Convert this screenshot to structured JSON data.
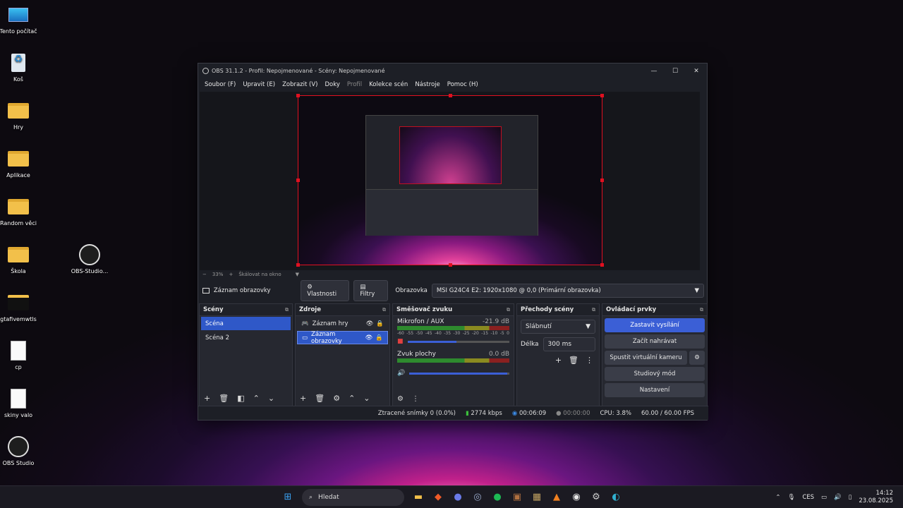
{
  "desktop": {
    "icons": [
      {
        "label": "Tento počítač"
      },
      {
        "label": "Koš"
      },
      {
        "label": "Hry"
      },
      {
        "label": "Aplikace"
      },
      {
        "label": "Random věci"
      },
      {
        "label": "Škola"
      },
      {
        "label": "OBS-Studio..."
      },
      {
        "label": "gtafivemwtls"
      },
      {
        "label": "cp"
      },
      {
        "label": "skiny valo"
      },
      {
        "label": "OBS Studio"
      }
    ]
  },
  "window": {
    "title": "OBS 31.1.2 - Profil: Nepojmenované - Scény: Nepojmenované",
    "controls": [
      "—",
      "☐",
      "✕"
    ]
  },
  "menu": [
    "Soubor (F)",
    "Upravit (E)",
    "Zobrazit (V)",
    "Doky",
    "Profil",
    "Kolekce scén",
    "Nástroje",
    "Pomoc (H)"
  ],
  "zoom": {
    "minus": "−",
    "value": "33%",
    "plus": "+",
    "mode": "Škálovat na okno"
  },
  "source_bar": {
    "name": "Záznam obrazovky",
    "properties": "Vlastnosti",
    "filters": "Filtry",
    "display_label": "Obrazovka",
    "display_value": "MSI G24C4 E2: 1920x1080 @ 0,0 (Primární obrazovka)"
  },
  "scenes": {
    "title": "Scény",
    "items": [
      "Scéna",
      "Scéna 2"
    ]
  },
  "sources": {
    "title": "Zdroje",
    "items": [
      "Záznam hry",
      "Záznam obrazovky"
    ]
  },
  "mixer": {
    "title": "Směšovač zvuku",
    "channels": [
      {
        "name": "Mikrofon / AUX",
        "db": "-21.9 dB",
        "level": 0.48
      },
      {
        "name": "Zvuk plochy",
        "db": "0.0 dB",
        "level": 0.98
      }
    ],
    "scale": [
      "-60",
      "-55",
      "-50",
      "-45",
      "-40",
      "-35",
      "-30",
      "-25",
      "-20",
      "-15",
      "-10",
      "-5",
      "0"
    ]
  },
  "transitions": {
    "title": "Přechody scény",
    "type": "Slábnutí",
    "duration_label": "Délka",
    "duration": "300 ms"
  },
  "controls": {
    "title": "Ovládací prvky",
    "stream": "Zastavit vysílání",
    "record": "Začít nahrávat",
    "virtualcam": "Spustit virtuální kameru",
    "studio": "Studiový mód",
    "settings": "Nastavení"
  },
  "status": {
    "dropped": "Ztracené snímky 0 (0.0%)",
    "bitrate": "2774 kbps",
    "stream_time": "00:06:09",
    "rec_time": "00:00:00",
    "cpu": "CPU: 3.8%",
    "fps": "60.00 / 60.00 FPS"
  },
  "taskbar": {
    "search": "Hledat",
    "lang": "CES",
    "time": "14:12",
    "date": "23.08.2025"
  }
}
